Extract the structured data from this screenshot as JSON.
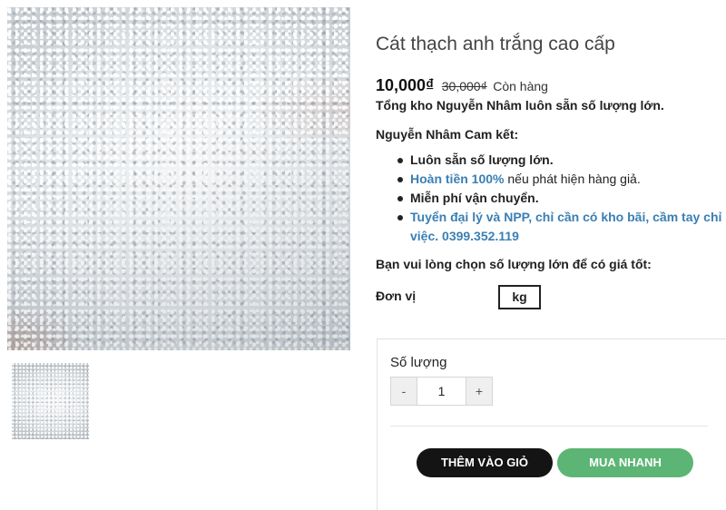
{
  "gallery": {
    "main_image": "white-quartz-sand-photo",
    "thumbnails": [
      "white-quartz-sand-thumbnail"
    ]
  },
  "product": {
    "title": "Cát thạch anh trắng cao cấp",
    "price_current": "10,000₫",
    "price_old": "30,000₫",
    "stock_status": "Còn hàng",
    "tagline": "Tổng kho Nguyễn Nhâm luôn sẵn số lượng lớn.",
    "commitment_heading": "Nguyễn Nhâm Cam kết:",
    "commitments": [
      {
        "text": "Luôn sẵn số lượng lớn."
      },
      {
        "highlight": "Hoàn tiền 100%",
        "text": " nếu phát hiện hàng giả."
      },
      {
        "text": "Miễn phí vận chuyển."
      },
      {
        "text": "Tuyển đại lý và NPP, chỉ cần có kho bãi, cầm tay chỉ việc. 0399.352.119"
      }
    ],
    "bulk_note": "Bạn vui lòng chọn số lượng lớn để có giá tốt:",
    "unit_label": "Đơn vị",
    "unit_value": "kg"
  },
  "purchase": {
    "quantity_label": "Số lượng",
    "decrement": "-",
    "quantity": "1",
    "increment": "+",
    "add_to_cart": "THÊM VÀO GIỎ",
    "buy_now": "MUA NHANH"
  },
  "colors": {
    "link_blue": "#3a7fb3",
    "buy_now_green": "#5cb574",
    "add_to_cart_black": "#141414"
  }
}
